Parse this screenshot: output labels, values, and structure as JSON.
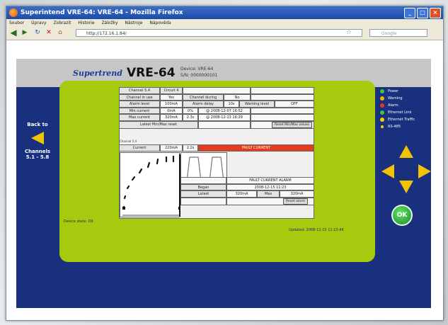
{
  "browser": {
    "title": "Superintend VRE-64: VRE-64 - Mozilla Firefox",
    "menu": [
      "Soubor",
      "Úpravy",
      "Zobrazit",
      "Historie",
      "Záložky",
      "Nástroje",
      "Nápověda"
    ],
    "url": "http://172.16.1.84/",
    "search_placeholder": "Google"
  },
  "header": {
    "logo": "Supertrend",
    "model": "VRE-64",
    "device_line": "Device: VRE-64",
    "sn_line": "S/N: 0000000101"
  },
  "nav": {
    "back_label": "Back to",
    "channels_label": "Channels",
    "range_label": "5.1 - 5.8"
  },
  "legend": [
    {
      "label": "Power",
      "color": "#3fc33c"
    },
    {
      "label": "Warning",
      "color": "#f0b400"
    },
    {
      "label": "Alarm",
      "color": "#e53d1c"
    },
    {
      "label": "Ethernet Link",
      "color": "#3fc33c"
    },
    {
      "label": "Ethernet Traffic",
      "color": "#f0d200"
    },
    {
      "label": "RS-485",
      "color": "#f0d200"
    }
  ],
  "table": {
    "row1": [
      "Channel 5.4",
      "Circuit 4"
    ],
    "row2": [
      "Channel in use",
      "Yes",
      "Channel during",
      "No"
    ],
    "row3": [
      "Alarm level",
      "100mA",
      "Alarm delay",
      "10s",
      "Warning level",
      "OFF"
    ],
    "row4": [
      "Min current",
      "0mA",
      "0%",
      "@ 2008-12-07 16:52"
    ],
    "row5": [
      "Max current",
      "320mA",
      "2.3s",
      "@ 2008-12-13 16:29"
    ],
    "row6": [
      "Latest Min/Max reset",
      ""
    ],
    "reset_minmax_btn": "Reset Min/Max values",
    "subhead": "Channel 5.4",
    "current": [
      "Current",
      "220mA",
      "2.2s"
    ],
    "current_status": "FAULT CURRENT",
    "fault_title": "FAULT CURRENT ALARM",
    "began_label": "Began",
    "began_value": "2008-12-15 11:23",
    "latest_label": "Latest",
    "latest_value": "320mA",
    "max_label": "Max",
    "max_value": "320mA",
    "reset_alarm_btn": "Reset alarm"
  },
  "footer": {
    "device_state": "Device state: OK",
    "updated": "Updated: 2008-12-15 11:23:46"
  },
  "ok_label": "OK"
}
